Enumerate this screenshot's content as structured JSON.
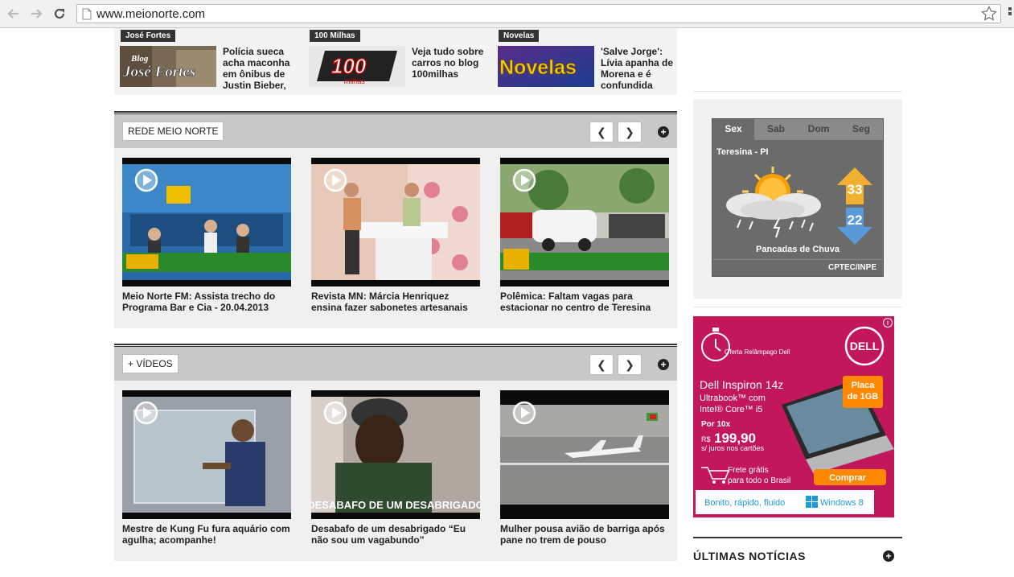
{
  "browser": {
    "url": "www.meionorte.com"
  },
  "blogs": [
    {
      "tag": "José Fortes",
      "text": "Polícia sueca acha maconha em ônibus de Justin Bieber,",
      "thumb_text": "José Fortes",
      "thumb_small": "Blog"
    },
    {
      "tag": "100 Milhas",
      "text": "Veja tudo sobre carros no blog 100milhas",
      "thumb_text": "100",
      "thumb_small": "milhas"
    },
    {
      "tag": "Novelas",
      "text": "'Salve Jorge': Lívia apanha de Morena e é confundida",
      "thumb_text": "Novelas"
    }
  ],
  "section_rede": {
    "title": "REDE MEIO NORTE",
    "prev": "❮",
    "next": "❯",
    "plus": "+",
    "videos": [
      {
        "caption": "Meio Norte FM: Assista trecho do Programa Bar e Cia - 20.04.2013"
      },
      {
        "caption": "Revista MN: Márcia Henriquez ensina fazer sabonetes artesanais"
      },
      {
        "caption": "Polêmica: Faltam vagas para estacionar no centro de Teresina"
      }
    ]
  },
  "section_videos": {
    "title": "+ VÍDEOS",
    "prev": "❮",
    "next": "❯",
    "plus": "+",
    "videos": [
      {
        "caption": "Mestre de Kung Fu fura aquário com agulha; acompanhe!"
      },
      {
        "caption": "Desabafo de um desabrigado “Eu não sou um vagabundo”",
        "overlay": "DESABAFO DE UM DESABRIGADO"
      },
      {
        "caption": "Mulher pousa avião de barriga após pane no trem de pouso"
      }
    ]
  },
  "weather": {
    "tabs": [
      "Sex",
      "Sab",
      "Dom",
      "Seg"
    ],
    "active_tab": "Sex",
    "city": "Teresina - PI",
    "high": "33",
    "low": "22",
    "condition": "Pancadas de Chuva",
    "source": "CPTEC/INPE"
  },
  "ad": {
    "flash_label": "Oferta Relâmpago Dell",
    "brand": "DELL",
    "product": "Dell Inspiron 14z",
    "line2": "Ultrabook™ com",
    "line3": "Intel® Core™ i5",
    "price_prefix": "Por 10x",
    "currency": "R$",
    "price": "199,90",
    "interest": "s/ juros nos cartões",
    "badge_line1": "Placa",
    "badge_line2": "de 1GB",
    "shipping1": "Frete grátis",
    "shipping2": "para todo o Brasil",
    "cta": "Comprar",
    "tagline": "Bonito, rápido, fluido",
    "os": "Windows 8",
    "info": "i"
  },
  "ultimas": {
    "title": "ÚLTIMAS NOTÍCIAS",
    "plus": "+"
  },
  "colors": {
    "section_header": "#c8c8c8",
    "ad_bg": "#c2185b",
    "ad_accent": "#ff8800",
    "weather_bg": "#6b6b6b"
  }
}
